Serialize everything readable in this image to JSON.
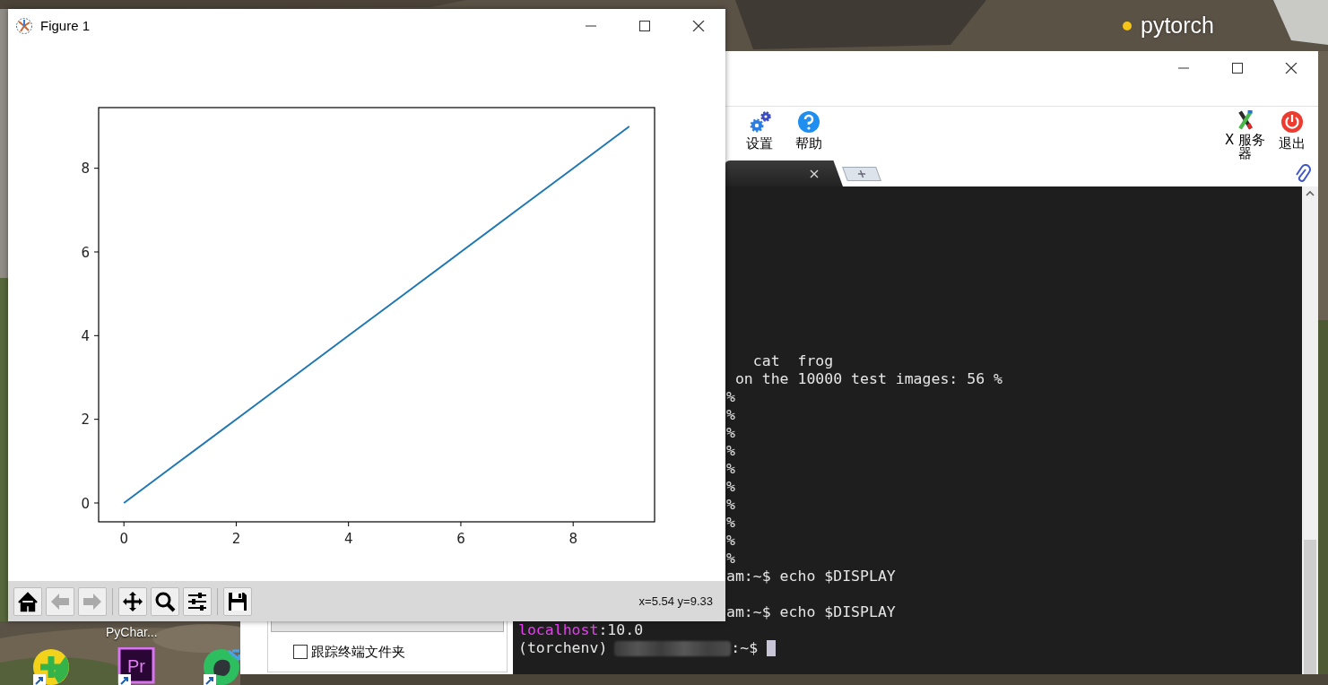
{
  "desktop": {
    "badge": {
      "label": "pytorch",
      "color": "#f5c518"
    },
    "icon_label": "PyChar...",
    "shortcuts": [
      {
        "kind": "plus"
      },
      {
        "kind": "letters",
        "label": "Pr"
      },
      {
        "kind": "elephant"
      }
    ]
  },
  "figure_window": {
    "title": "Figure 1",
    "chart_data": {
      "type": "line",
      "x": [
        0,
        1,
        2,
        3,
        4,
        5,
        6,
        7,
        8,
        9
      ],
      "series": [
        {
          "color": "#1f77b4",
          "values": [
            0,
            1,
            2,
            3,
            4,
            5,
            6,
            7,
            8,
            9
          ]
        }
      ],
      "xlim": [
        -0.45,
        9.45
      ],
      "ylim": [
        -0.45,
        9.45
      ],
      "xticks": [
        0,
        2,
        4,
        6,
        8
      ],
      "yticks": [
        0,
        2,
        4,
        6,
        8
      ]
    },
    "toolbar_groups": [
      {
        "buttons": [
          {
            "kind": "home",
            "disabled": false
          },
          {
            "kind": "back",
            "disabled": true
          },
          {
            "kind": "forward",
            "disabled": true
          }
        ]
      },
      {
        "buttons": [
          {
            "kind": "pan",
            "disabled": false
          },
          {
            "kind": "zoom",
            "disabled": false
          },
          {
            "kind": "subplots",
            "disabled": false
          }
        ]
      },
      {
        "buttons": [
          {
            "kind": "save",
            "disabled": false
          }
        ]
      }
    ],
    "coordinates": "x=5.54 y=9.33"
  },
  "terminal_window": {
    "toolbar": {
      "main": [
        {
          "kind": "settings",
          "label": "设置"
        },
        {
          "kind": "help",
          "label": "帮助"
        }
      ],
      "end": [
        {
          "kind": "xserver",
          "label": "X 服务器"
        },
        {
          "kind": "exit",
          "label": "退出"
        }
      ]
    },
    "sidebar": {
      "checkbox": {
        "label": "跟踪终端文件夹",
        "checked": false
      }
    },
    "terminal": {
      "partly_covered_lines": [
        {
          "kind": "text",
          "text": "   cat  frog"
        },
        {
          "kind": "text",
          "text": " on the 10000 test images: 56 %"
        },
        {
          "kind": "text",
          "text": "%"
        },
        {
          "kind": "text",
          "text": "%"
        },
        {
          "kind": "text",
          "text": "%"
        },
        {
          "kind": "text",
          "text": "%"
        },
        {
          "kind": "text",
          "text": "%"
        },
        {
          "kind": "text",
          "text": "%"
        },
        {
          "kind": "text",
          "text": "%"
        },
        {
          "kind": "text",
          "text": "%"
        },
        {
          "kind": "text",
          "text": "%"
        },
        {
          "kind": "text",
          "text": "%"
        },
        {
          "kind": "text",
          "text": "am:~$ echo $DISPLAY"
        },
        {
          "kind": "blank"
        },
        {
          "kind": "text",
          "text": "am:~$ echo $DISPLAY"
        }
      ],
      "lines": [
        {
          "kind": "output",
          "parts": [
            {
              "text": "localhost",
              "color": "#e83ef2"
            },
            {
              "text": ":10.0",
              "color": "#e6e6e6"
            }
          ]
        },
        {
          "kind": "prompt",
          "env": "(torchenv)",
          "redacted": true,
          "suffix": ":~$",
          "cursor": true
        }
      ]
    }
  }
}
